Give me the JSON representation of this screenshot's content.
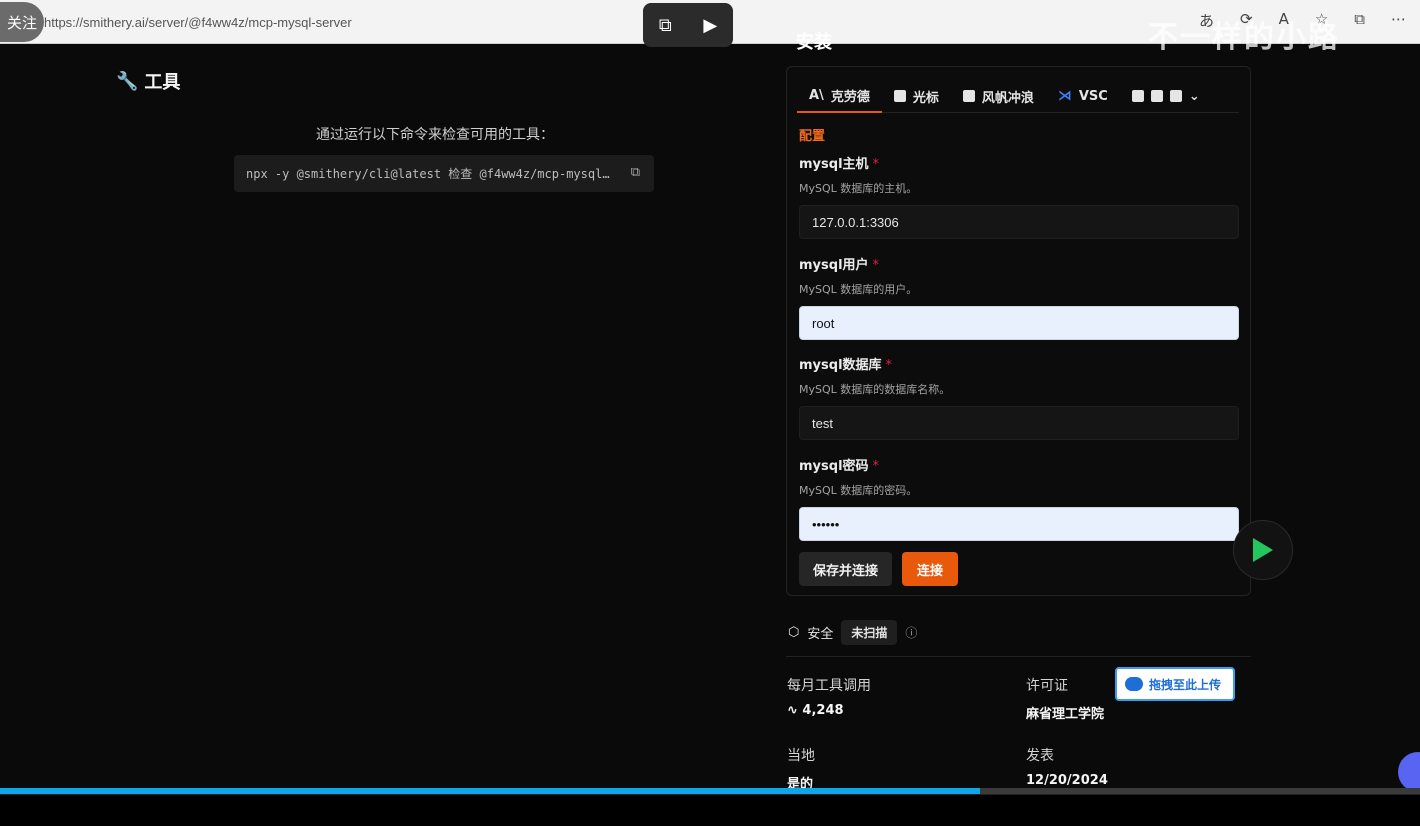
{
  "browser": {
    "url": "https://smithery.ai/server/@f4ww4z/mcp-mysql-server",
    "follow_label": "关注",
    "overlay_text": "不一样的小路"
  },
  "section_title": "安装",
  "tools": {
    "title": "工具",
    "hint": "通过运行以下命令来检查可用的工具：",
    "command": "npx -y @smithery/cli@latest 检查 @f4ww4z/mcp-mysql…"
  },
  "install": {
    "tabs": [
      {
        "label": "克劳德",
        "icon": "anthropic-icon"
      },
      {
        "label": "光标",
        "icon": "cursor-icon"
      },
      {
        "label": "风帆冲浪",
        "icon": "windsurf-icon"
      },
      {
        "label": "VSC",
        "icon": "vscode-icon"
      }
    ],
    "config_title": "配置",
    "fields": [
      {
        "label": "mysql主机",
        "desc": "MySQL 数据库的主机。",
        "value": "127.0.0.1:3306",
        "style": "dark"
      },
      {
        "label": "mysql用户",
        "desc": "MySQL 数据库的用户。",
        "value": "root",
        "style": "light"
      },
      {
        "label": "mysql数据库",
        "desc": "MySQL 数据库的数据库名称。",
        "value": "test",
        "style": "dark"
      },
      {
        "label": "mysql密码",
        "desc": "MySQL 数据库的密码。",
        "value": "••••••",
        "style": "light"
      }
    ],
    "required_mark": "*",
    "save_label": "保存并连接",
    "connect_label": "连接"
  },
  "security": {
    "label": "安全",
    "status": "未扫描"
  },
  "stats": {
    "monthly_calls_label": "每月工具调用",
    "monthly_calls_value": "4,248",
    "license_label": "许可证",
    "license_value": "麻省理工学院",
    "local_label": "当地",
    "local_value": "是的",
    "published_label": "发表",
    "published_value": "12/20/2024"
  },
  "upload_label": "拖拽至此上传",
  "video_progress": 0.69,
  "colors": {
    "accent": "#e8590c",
    "progress": "#0ea5e9"
  }
}
